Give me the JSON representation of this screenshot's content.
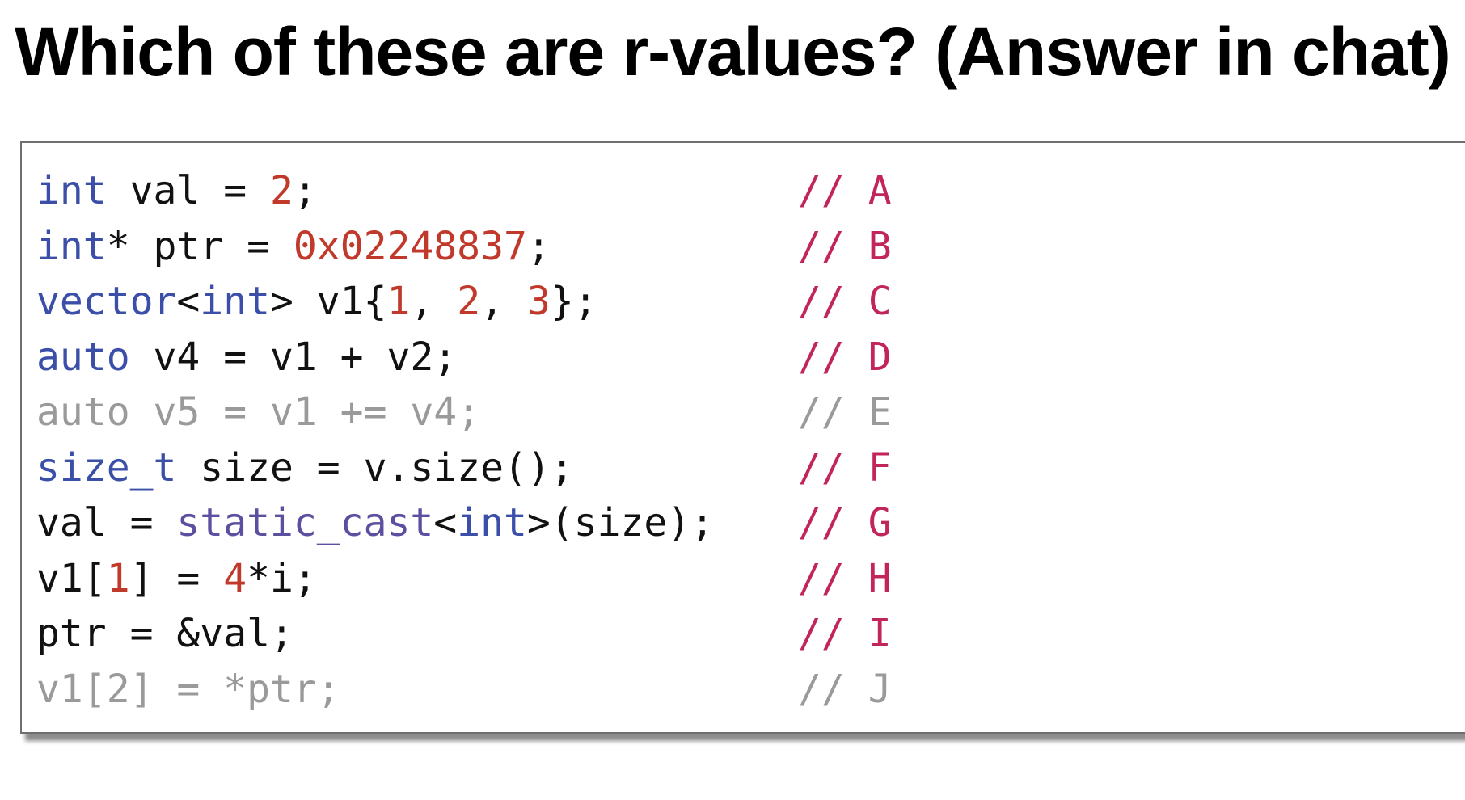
{
  "title": "Which of these are r-values? (Answer in chat)",
  "colors": {
    "keyword": "#3b4fa8",
    "number": "#c0392b",
    "function": "#5b4fa0",
    "comment": "#c2255c",
    "dimmed": "#9a9a9a",
    "text": "#111111"
  },
  "code": {
    "lines": [
      {
        "dim": false,
        "comment": "// A",
        "tokens": [
          [
            "kw",
            "int"
          ],
          [
            "plain",
            " val = "
          ],
          [
            "num",
            "2"
          ],
          [
            "plain",
            ";"
          ]
        ]
      },
      {
        "dim": false,
        "comment": "// B",
        "tokens": [
          [
            "kw",
            "int"
          ],
          [
            "plain",
            "* ptr = "
          ],
          [
            "num",
            "0x02248837"
          ],
          [
            "plain",
            ";"
          ]
        ]
      },
      {
        "dim": false,
        "comment": "// C",
        "tokens": [
          [
            "kw",
            "vector"
          ],
          [
            "plain",
            "<"
          ],
          [
            "kw",
            "int"
          ],
          [
            "plain",
            "> v1{"
          ],
          [
            "num",
            "1"
          ],
          [
            "plain",
            ", "
          ],
          [
            "num",
            "2"
          ],
          [
            "plain",
            ", "
          ],
          [
            "num",
            "3"
          ],
          [
            "plain",
            "};"
          ]
        ]
      },
      {
        "dim": false,
        "comment": "// D",
        "tokens": [
          [
            "kw",
            "auto"
          ],
          [
            "plain",
            " v4 = v1 + v2;"
          ]
        ]
      },
      {
        "dim": true,
        "comment": "// E",
        "tokens": [
          [
            "plain",
            "auto v5 = v1 += v4;"
          ]
        ]
      },
      {
        "dim": false,
        "comment": "// F",
        "tokens": [
          [
            "kw",
            "size_t"
          ],
          [
            "plain",
            " size = v.size();"
          ]
        ]
      },
      {
        "dim": false,
        "comment": "// G",
        "tokens": [
          [
            "plain",
            "val = "
          ],
          [
            "fn",
            "static_cast"
          ],
          [
            "plain",
            "<"
          ],
          [
            "kw",
            "int"
          ],
          [
            "plain",
            ">(size);"
          ]
        ]
      },
      {
        "dim": false,
        "comment": "// H",
        "tokens": [
          [
            "plain",
            "v1["
          ],
          [
            "num",
            "1"
          ],
          [
            "plain",
            "] = "
          ],
          [
            "num",
            "4"
          ],
          [
            "plain",
            "*i;"
          ]
        ]
      },
      {
        "dim": false,
        "comment": "// I",
        "tokens": [
          [
            "plain",
            "ptr = &val;"
          ]
        ]
      },
      {
        "dim": true,
        "comment": "// J",
        "tokens": [
          [
            "plain",
            "v1[2] = *ptr;"
          ]
        ]
      }
    ]
  }
}
